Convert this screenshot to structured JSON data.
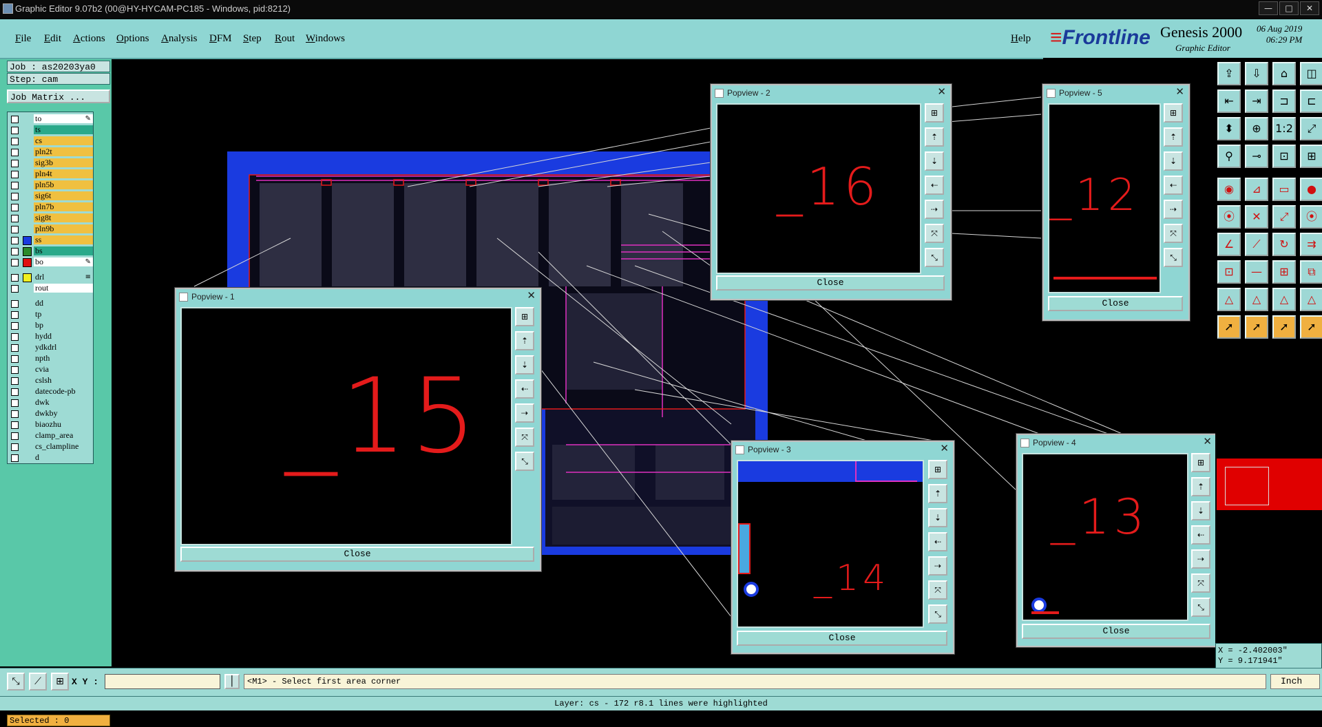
{
  "window": {
    "title": "Graphic Editor 9.07b2 (00@HY-HYCAM-PC185 - Windows, pid:8212)",
    "controls": [
      "—",
      "□",
      "✕"
    ]
  },
  "menu": {
    "items": [
      "File",
      "Edit",
      "Actions",
      "Options",
      "Analysis",
      "DFM",
      "Step",
      "Rout",
      "Windows"
    ],
    "help": "Help"
  },
  "branding": {
    "logo_front": "Frontline",
    "product": "Genesis 2000",
    "subtitle": "Graphic Editor",
    "date": "06 Aug 2019",
    "time": "06:29 PM"
  },
  "job": {
    "job_text": "Job : as20203ya0",
    "step_text": "Step: cam",
    "matrix_button": "Job Matrix ..."
  },
  "layers": [
    {
      "name": "to",
      "color": "#ffffff",
      "mark": "✎"
    },
    {
      "name": "ts",
      "color": "#2aa98a"
    },
    {
      "name": "cs",
      "color": "#f0c040"
    },
    {
      "name": "pln2t",
      "color": "#f0c040"
    },
    {
      "name": "sig3b",
      "color": "#f0c040"
    },
    {
      "name": "pln4t",
      "color": "#f0c040"
    },
    {
      "name": "pln5b",
      "color": "#f0c040"
    },
    {
      "name": "sig6t",
      "color": "#f0c040"
    },
    {
      "name": "pln7b",
      "color": "#f0c040"
    },
    {
      "name": "sig8t",
      "color": "#f0c040"
    },
    {
      "name": "pln9b",
      "color": "#f0c040"
    },
    {
      "name": "ss",
      "color": "#f0c040",
      "swatch": "#1a3be0"
    },
    {
      "name": "bs",
      "color": "#2aa98a",
      "swatch": "#2a8a2a"
    },
    {
      "name": "bo",
      "color": "#ffffff",
      "swatch": "#e01010",
      "mark": "✎"
    },
    {
      "name": "drl",
      "color": "#9edbd4",
      "swatch": "#f0f020",
      "mark": "≡",
      "sep": true
    },
    {
      "name": "rout",
      "color": "#ffffff"
    },
    {
      "name": "dd",
      "color": "#9edbd4",
      "sep": true
    },
    {
      "name": "tp",
      "color": "#9edbd4"
    },
    {
      "name": "bp",
      "color": "#9edbd4"
    },
    {
      "name": "hydd",
      "color": "#9edbd4"
    },
    {
      "name": "ydkdrl",
      "color": "#9edbd4"
    },
    {
      "name": "npth",
      "color": "#9edbd4"
    },
    {
      "name": "cvia",
      "color": "#9edbd4"
    },
    {
      "name": "cslsh",
      "color": "#9edbd4"
    },
    {
      "name": "datecode-pb",
      "color": "#9edbd4"
    },
    {
      "name": "dwk",
      "color": "#9edbd4"
    },
    {
      "name": "dwkby",
      "color": "#9edbd4"
    },
    {
      "name": "biaozhu",
      "color": "#9edbd4"
    },
    {
      "name": "clamp_area",
      "color": "#9edbd4"
    },
    {
      "name": "cs_clampline",
      "color": "#9edbd4"
    },
    {
      "name": "d",
      "color": "#9edbd4"
    }
  ],
  "selected": "Selected : 0",
  "popviews": [
    {
      "title": "Popview - 1",
      "number": "_15",
      "close": "Close"
    },
    {
      "title": "Popview - 2",
      "number": "_16",
      "close": "Close"
    },
    {
      "title": "Popview - 3",
      "number": "_14",
      "close": "Close"
    },
    {
      "title": "Popview - 4",
      "number": "_13",
      "close": "Close"
    },
    {
      "title": "Popview - 5",
      "number": "_12",
      "close": "Close"
    }
  ],
  "popview_buttons": [
    "⊞",
    "⇡",
    "⇣",
    "⇠",
    "⇢",
    "⤧",
    "⤡"
  ],
  "toolbox_icons": [
    "⇪",
    "⇩",
    "⌂",
    "◫",
    "⇤",
    "⇥",
    "⊐",
    "⊏",
    "⬍",
    "⊕",
    "1:2",
    "⤢",
    "⚲",
    "⊸",
    "⊡",
    "⊞",
    "◉",
    "⊿",
    "▭",
    "●",
    "⦿",
    "✕",
    "⤢",
    "⦿",
    "∠",
    "⟋",
    "↻",
    "⇉",
    "⊡",
    "—",
    "⊞",
    "⧉",
    "△",
    "△",
    "△",
    "△",
    "➚",
    "➚",
    "➚",
    "➚"
  ],
  "coords": {
    "x": "X = -2.402003\"",
    "y": "Y = 9.171941\""
  },
  "command": {
    "xy_label": "X Y :",
    "xy_value": "",
    "prompt": "<M1> - Select first area corner",
    "units": "Inch",
    "icons": [
      "⤡",
      "⟋",
      "⊞"
    ]
  },
  "status": "Layer: cs - 172 r8.1 lines were highlighted",
  "colors": {
    "panel": "#8fd6d3",
    "sidebar": "#59c8a8",
    "board": "#1a3be0",
    "highlight_red": "#e41b1b",
    "magenta": "#e030c0"
  }
}
